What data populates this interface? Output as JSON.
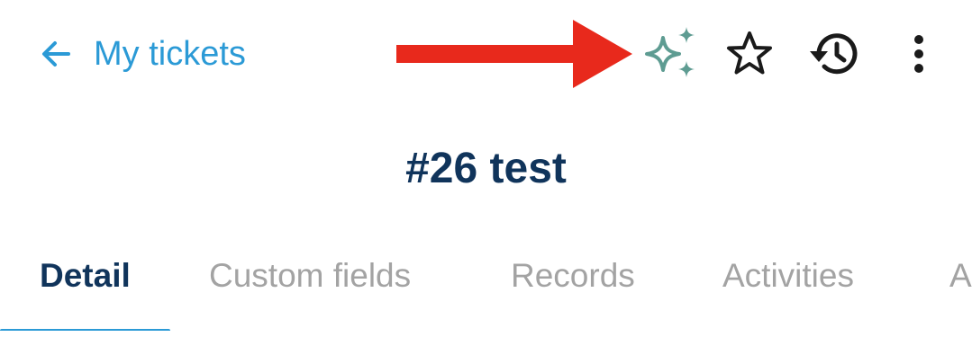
{
  "header": {
    "back_label": "My tickets",
    "icons": {
      "back": "arrow-left-icon",
      "ai": "sparkles-icon",
      "favorite": "star-outline-icon",
      "history": "history-icon",
      "more": "more-vertical-icon"
    }
  },
  "ticket": {
    "title": "#26 test"
  },
  "tabs": [
    {
      "label": "Detail",
      "active": true
    },
    {
      "label": "Custom fields",
      "active": false
    },
    {
      "label": "Records",
      "active": false
    },
    {
      "label": "Activities",
      "active": false
    },
    {
      "label": "A",
      "active": false
    }
  ],
  "colors": {
    "accent": "#2b9ad6",
    "title": "#10345b",
    "inactive_tab": "#a3a3a3",
    "ai_icon": "#5e9c92",
    "annotation_arrow": "#e8291c"
  }
}
